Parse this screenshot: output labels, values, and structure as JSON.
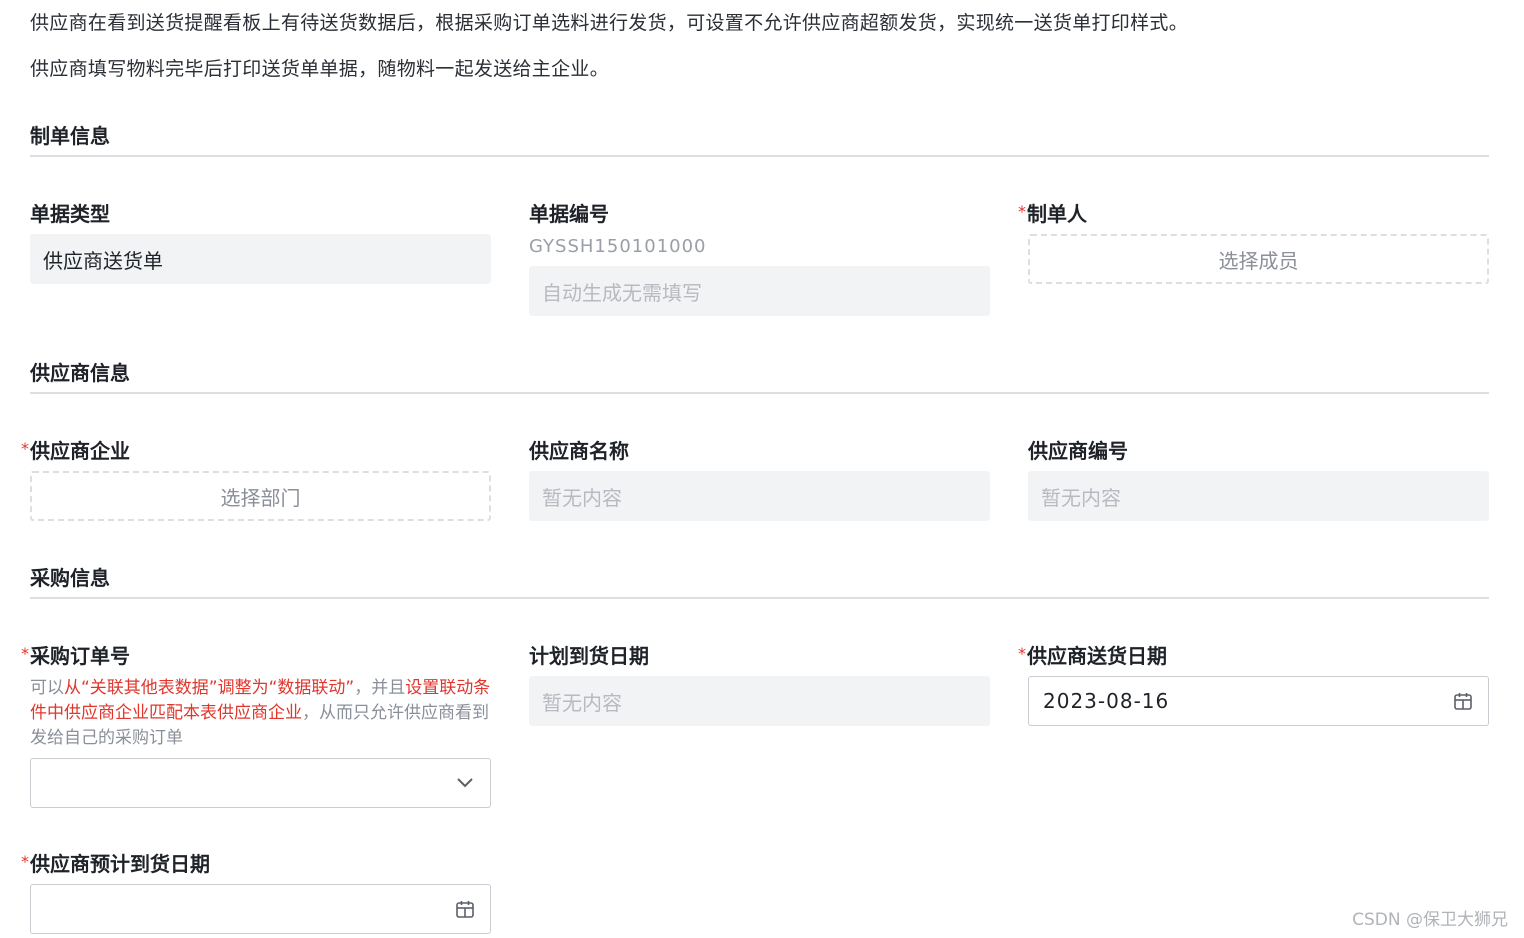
{
  "intro": {
    "line1": "供应商在看到送货提醒看板上有待送货数据后，根据采购订单选料进行发货，可设置不允许供应商超额发货，实现统一送货单打印样式。",
    "line2": "供应商填写物料完毕后打印送货单单据，随物料一起发送给主企业。"
  },
  "sections": {
    "order_info": {
      "title": "制单信息",
      "doc_type": {
        "label": "单据类型",
        "value": "供应商送货单"
      },
      "doc_no": {
        "label": "单据编号",
        "code": "GYSSH150101000",
        "placeholder": "自动生成无需填写"
      },
      "creator": {
        "required": "*",
        "label": "制单人",
        "button": "选择成员"
      }
    },
    "supplier_info": {
      "title": "供应商信息",
      "supplier_company": {
        "required": "*",
        "label": "供应商企业",
        "button": "选择部门"
      },
      "supplier_name": {
        "label": "供应商名称",
        "placeholder": "暂无内容"
      },
      "supplier_code": {
        "label": "供应商编号",
        "placeholder": "暂无内容"
      }
    },
    "purchase_info": {
      "title": "采购信息",
      "po_number": {
        "required": "*",
        "label": "采购订单号",
        "hint_part1": "可以",
        "hint_red1": "从“关联其他表数据”调整为“数据联动”",
        "hint_part2": "，并且",
        "hint_red2": "设置联动条件中供应商企业匹配本表供应商企业",
        "hint_part3": "，从而只允许供应商看到发给自己的采购订单",
        "value": ""
      },
      "planned_date": {
        "label": "计划到货日期",
        "placeholder": "暂无内容"
      },
      "supplier_delivery_date": {
        "required": "*",
        "label": "供应商送货日期",
        "value": "2023-08-16"
      },
      "supplier_expected_date": {
        "required": "*",
        "label": "供应商预计到货日期",
        "value": ""
      }
    }
  },
  "watermark": "CSDN @保卫大狮兄",
  "colors": {
    "required": "#e0362c",
    "hint_red": "#e0362c",
    "divider": "#dcdee2",
    "field_bg": "#f2f3f5"
  }
}
